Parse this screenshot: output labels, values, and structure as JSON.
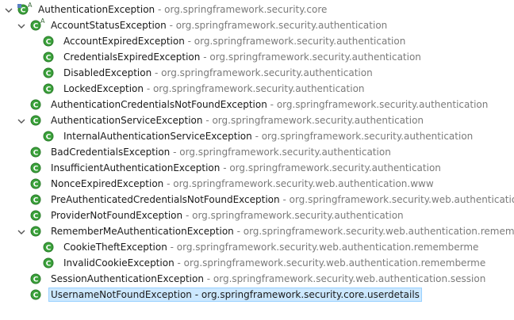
{
  "tree": {
    "rows": [
      {
        "name": "AuthenticationException",
        "package": "org.springframework.security.core",
        "depth": 0,
        "expanded": true,
        "abstract": true
      },
      {
        "name": "AccountStatusException",
        "package": "org.springframework.security.authentication",
        "depth": 1,
        "expanded": true,
        "abstract": true
      },
      {
        "name": "AccountExpiredException",
        "package": "org.springframework.security.authentication",
        "depth": 2
      },
      {
        "name": "CredentialsExpiredException",
        "package": "org.springframework.security.authentication",
        "depth": 2
      },
      {
        "name": "DisabledException",
        "package": "org.springframework.security.authentication",
        "depth": 2
      },
      {
        "name": "LockedException",
        "package": "org.springframework.security.authentication",
        "depth": 2
      },
      {
        "name": "AuthenticationCredentialsNotFoundException",
        "package": "org.springframework.security.authentication",
        "depth": 1
      },
      {
        "name": "AuthenticationServiceException",
        "package": "org.springframework.security.authentication",
        "depth": 1,
        "expanded": true
      },
      {
        "name": "InternalAuthenticationServiceException",
        "package": "org.springframework.security.authentication",
        "depth": 2
      },
      {
        "name": "BadCredentialsException",
        "package": "org.springframework.security.authentication",
        "depth": 1
      },
      {
        "name": "InsufficientAuthenticationException",
        "package": "org.springframework.security.authentication",
        "depth": 1
      },
      {
        "name": "NonceExpiredException",
        "package": "org.springframework.security.web.authentication.www",
        "depth": 1
      },
      {
        "name": "PreAuthenticatedCredentialsNotFoundException",
        "package": "org.springframework.security.web.authentication.p",
        "depth": 1
      },
      {
        "name": "ProviderNotFoundException",
        "package": "org.springframework.security.authentication",
        "depth": 1
      },
      {
        "name": "RememberMeAuthenticationException",
        "package": "org.springframework.security.web.authentication.rememberr",
        "depth": 1,
        "expanded": true
      },
      {
        "name": "CookieTheftException",
        "package": "org.springframework.security.web.authentication.rememberme",
        "depth": 2
      },
      {
        "name": "InvalidCookieException",
        "package": "org.springframework.security.web.authentication.rememberme",
        "depth": 2
      },
      {
        "name": "SessionAuthenticationException",
        "package": "org.springframework.security.web.authentication.session",
        "depth": 1
      },
      {
        "name": "UsernameNotFoundException",
        "package": "org.springframework.security.core.userdetails",
        "depth": 1,
        "selected": true
      }
    ],
    "separator": " - ",
    "abstract_marker": "A",
    "class_icon_letter": "C"
  },
  "colors": {
    "class_icon_fill": "#3ba23b",
    "class_icon_text": "#ffffff",
    "package_text": "#7a7a7a",
    "selection_bg": "#cce8ff",
    "selection_border": "#99d1ff",
    "expander": "#555555",
    "root_badge": "#5a7fc2"
  },
  "icons": {
    "class": "class-icon",
    "abstract_class": "abstract-class-icon",
    "root": "hierarchy-root-icon",
    "expander": "chevron-down-icon"
  }
}
